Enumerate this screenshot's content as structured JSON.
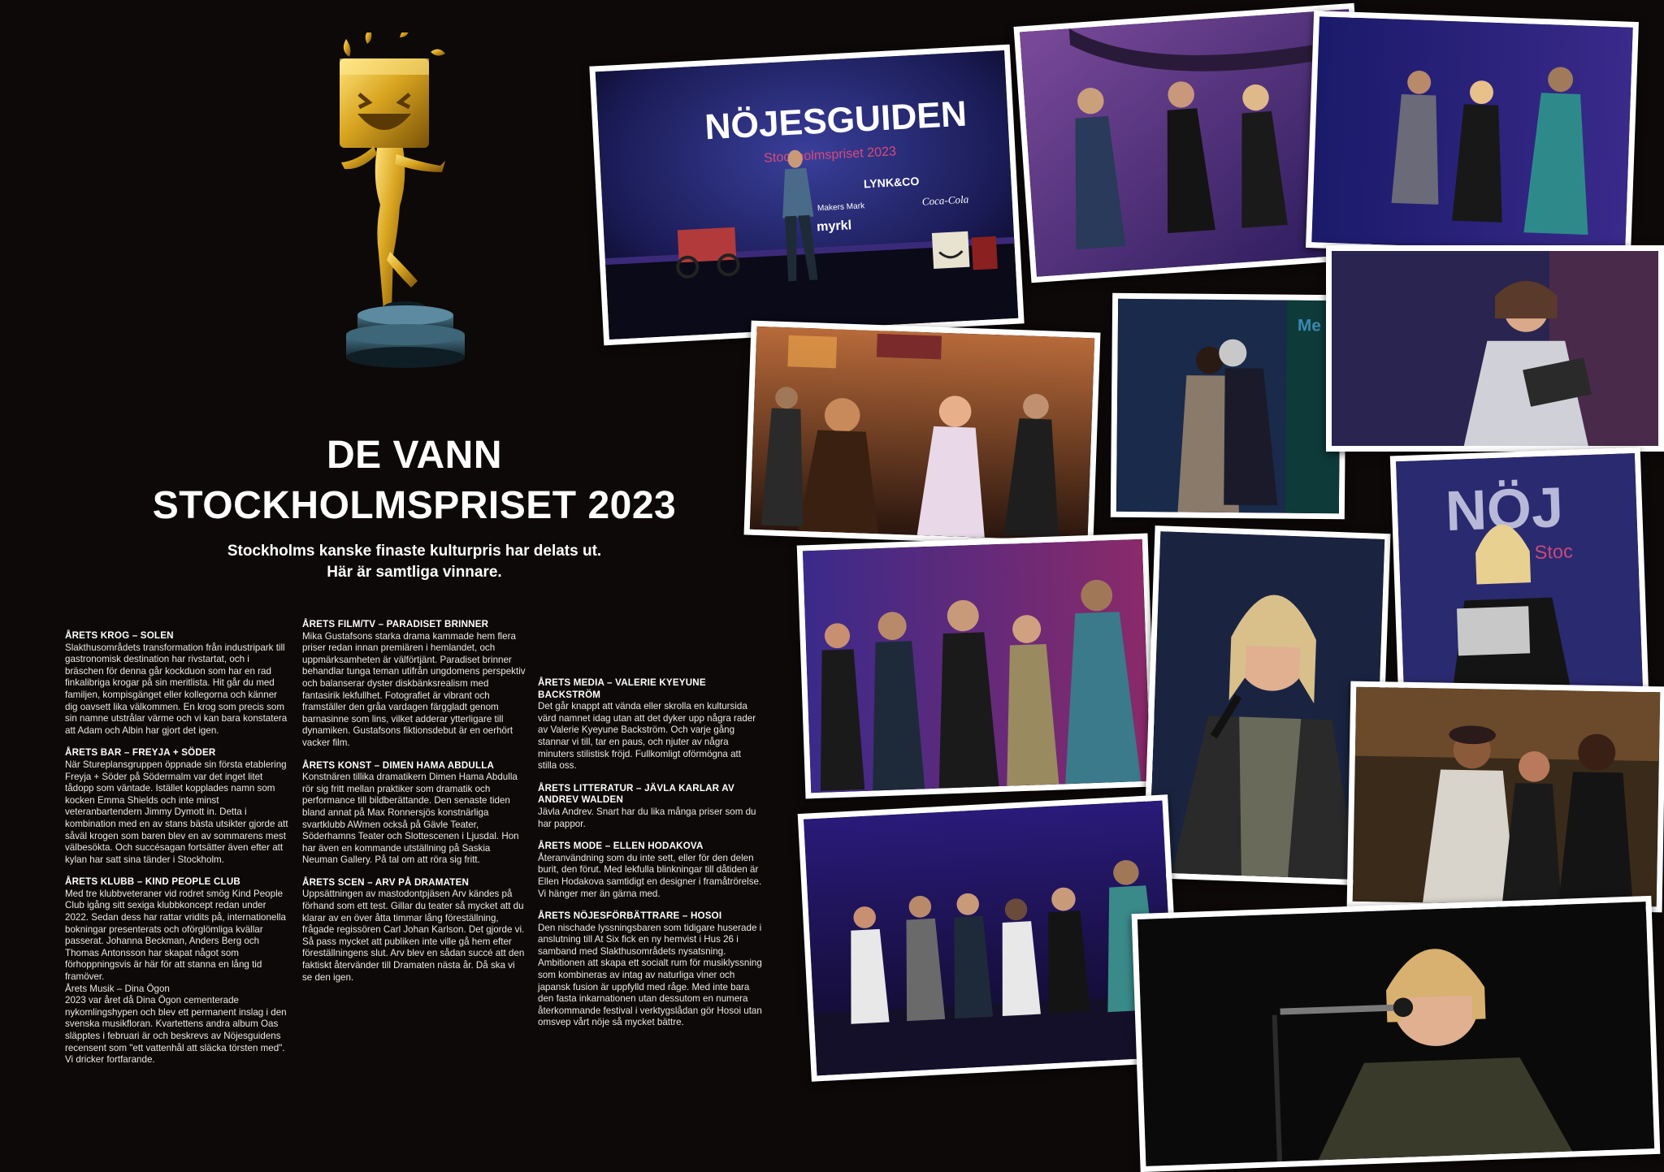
{
  "headline": {
    "line1": "DE VANN",
    "line2": "STOCKHOLMSPRISET 2023"
  },
  "intro": {
    "line1": "Stockholms kanske finaste kulturpris har delats ut.",
    "line2": "Här är samtliga vinnare."
  },
  "sections": [
    {
      "heading": "Årets krog – Solen",
      "body": "Slakthusområdets transformation från industripark till gastronomisk destination har rivstartat, och i bräschen för denna går kockduon som har en rad finkalibriga krogar på sin meritlista. Hit går du med familjen, kompisgänget eller kollegorna och känner dig oavsett lika välkommen. En krog som precis som sin namne utstrålar värme och vi kan bara konstatera att Adam och Albin har gjort det igen."
    },
    {
      "heading": "Årets bar – Freyja + Söder",
      "body": "När Stureplansgruppen öppnade sin första etablering Freyja + Söder på Södermalm var det inget litet tådopp som väntade. Istället kopplades namn som kocken Emma Shields och inte minst veteranbartendern Jimmy Dymott in. Detta i kombination med en av stans bästa utsikter gjorde att såväl krogen som baren blev en av sommarens mest välbesökta. Och succésagan fortsätter även efter att kylan har satt sina tänder i Stockholm."
    },
    {
      "heading": "Årets klubb – Kind People Club",
      "body": "Med tre klubbveteraner vid rodret smög Kind People Club igång sitt sexiga klubbkoncept redan under 2022. Sedan dess har rattar vridits på, internationella bokningar presenterats och oförglömliga kvällar passerat. Johanna Beckman, Anders Berg och Thomas Antonsson har skapat något som förhoppningsvis är här för att stanna en lång tid framöver.",
      "extra": "Årets Musik – Dina Ögon",
      "extra_body": "2023 var året då Dina Ögon cementerade nykomlingshypen och blev ett permanent inslag i den svenska musikfloran. Kvartettens andra album Oas släpptes i februari är och beskrevs av Nöjesguidens recensent som \"ett vattenhål att släcka törsten med\". Vi dricker fortfarande."
    },
    {
      "heading": "Årets film/tv – Paradiset brinner",
      "body": "Mika Gustafsons starka drama kammade hem flera priser redan innan premiären i hemlandet, och uppmärksamheten är välförtjänt. Paradiset brinner behandlar tunga teman utifrån ungdomens perspektiv och balanserar dyster diskbänksrealism med fantasirik lekfullhet. Fotografiet är vibrant och framställer den gråa vardagen färggladt genom barnasinne som lins, vilket adderar ytterligare till dynamiken. Gustafsons fiktionsdebut är en oerhört vacker film."
    },
    {
      "heading": "Årets konst – Dimen Hama Abdulla",
      "body": "Konstnären tillika dramatikern Dimen Hama Abdulla rör sig fritt mellan praktiker som dramatik och performance till bildberättande. Den senaste tiden bland annat på Max Ronnersjös konstnärliga svartklubb AWmen också på Gävle Teater, Söderhamns Teater och Slottescenen i Ljusdal. Hon har även en kommande utställning på Saskia Neuman Gallery. På tal om att röra sig fritt."
    },
    {
      "heading": "Årets scen – Arv på Dramaten",
      "body": "Uppsättningen av mastodontpjäsen Arv kändes på förhand som ett test. Gillar du teater så mycket att du klarar av en över åtta timmar lång föreställning, frågade regissören Carl Johan Karlson. Det gjorde vi. Så pass mycket att publiken inte ville gå hem efter föreställningens slut. Arv blev en sådan succé att den faktiskt återvänder till Dramaten nästa år. Då ska vi se den igen."
    },
    {
      "heading": "Årets media – Valerie Kyeyune Backström",
      "body": "Det går knappt att vända eller skrolla en kultursida värd namnet idag utan att det dyker upp några rader av Valerie Kyeyune Backström. Och varje gång stannar vi till, tar en paus, och njuter av några minuters stilistisk fröjd. Fullkomligt oförmögna att stilla oss."
    },
    {
      "heading": "Årets litteratur – Jävla karlar av Andrev Walden",
      "body": "Jävla Andrev. Snart har du lika många priser som du har pappor."
    },
    {
      "heading": "Årets mode – Ellen Hodakova",
      "body": "Återanvändning som du inte sett, eller för den delen burit, den förut. Med lekfulla blinkningar till dåtiden är Ellen Hodakova samtidigt en designer i framåtrörelse. Vi hänger mer än gärna med."
    },
    {
      "heading": "Årets nöjesförbättrare – Hosoi",
      "body": "Den nischade lyssningsbaren som tidigare huserade i anslutning till At Six fick en ny hemvist i Hus 26 i samband med Slakthusområdets nysatsning. Ambitionen att skapa ett socialt rum för musiklyssning som kombineras av intag av naturliga viner och japansk fusion är uppfylld med råge. Med inte bara den fasta inkarnationen utan dessutom en numera återkommande festival i verktygslådan gör Hosoi utan omsvep vårt nöje så mycket bättre."
    }
  ],
  "stage_signage": {
    "main_logo": "NÖJESGUIDEN",
    "event": "Stockholmspriset 2023",
    "sponsors": [
      "LYNK&CO",
      "Coca-Cola",
      "Makers Mark",
      "myrkl"
    ],
    "side_logo": "NÖJ",
    "side_sub": "Stoc",
    "side_sign": "Me"
  },
  "colors": {
    "background": "#0d0908",
    "photo_frame": "#ffffff",
    "stage_blue": "#2c2f7a",
    "stage_purple": "#5a2a8c",
    "trophy_gold": "#d9a520",
    "trophy_base": "#1f3a4a"
  }
}
